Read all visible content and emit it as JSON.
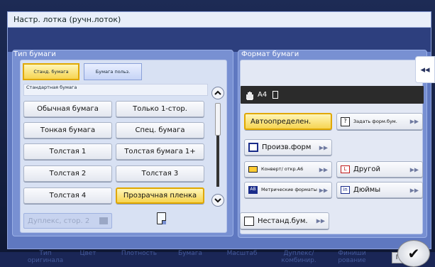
{
  "window": {
    "title": "Настр. лотка (ручн.лоток)"
  },
  "background_text": "",
  "paper_type": {
    "title": "Тип бумаги",
    "tabs": [
      {
        "label": "Станд. бумага",
        "selected": true
      },
      {
        "label": "Бумага польз.",
        "selected": false
      }
    ],
    "list_header": "Стандартная бумага",
    "options": [
      {
        "label": "Обычная бумага",
        "selected": false
      },
      {
        "label": "Только 1-стор.",
        "selected": false
      },
      {
        "label": "Тонкая бумага",
        "selected": false
      },
      {
        "label": "Спец. бумага",
        "selected": false
      },
      {
        "label": "Толстая 1",
        "selected": false
      },
      {
        "label": "Толстая бумага 1+",
        "selected": false
      },
      {
        "label": "Толстая 2",
        "selected": false
      },
      {
        "label": "Толстая 3",
        "selected": false
      },
      {
        "label": "Толстая 4",
        "selected": false
      },
      {
        "label": "Прозрачная пленка",
        "selected": true
      }
    ],
    "duplex_label": "Дуплекс, стор. 2"
  },
  "paper_size": {
    "title": "Формат бумаги",
    "status_size": "A4",
    "buttons": {
      "auto": "Автоопределен.",
      "custom": "Задать форм.бум.",
      "photo": "Произв.форм",
      "envelope": "Конверт/ откр.А6",
      "other": "Другой",
      "metric": "Метрические форматы",
      "inch": "Дюймы",
      "nonstandard": "Нестанд.бум."
    }
  },
  "bottom_bar": {
    "items": [
      "Тип оригинала",
      "Цвет",
      "Плотность",
      "Бумага",
      "Масштаб",
      "Дуплекс/ комбинир.",
      "Финиши рование"
    ],
    "ok_symbol": "✔",
    "partial_label": "Пр"
  },
  "colors": {
    "accent": "#f6d451",
    "panel": "#7890d2",
    "frame": "#5f78c0"
  }
}
